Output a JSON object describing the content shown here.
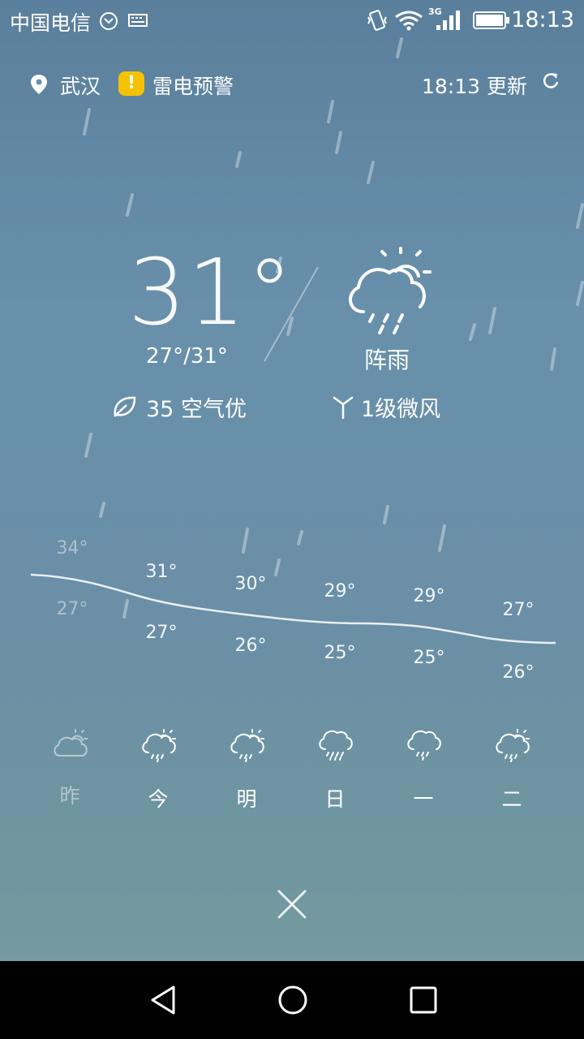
{
  "status_bar": {
    "carrier": "中国电信",
    "network": "3G",
    "time": "18:13"
  },
  "header": {
    "location": "武汉",
    "warning_mark": "!",
    "warning": "雷电预警",
    "update_time": "18:13 更新",
    "warning_color": "#f6c200"
  },
  "current": {
    "temperature": "31°",
    "range": "27°/31°",
    "condition": "阵雨",
    "aqi": "35 空气优",
    "wind": "1级微风"
  },
  "forecast": {
    "days": [
      {
        "label": "昨",
        "high": "34°",
        "low": "27°",
        "icon": "cloudy-sun-icon",
        "past": true
      },
      {
        "label": "今",
        "high": "31°",
        "low": "27°",
        "icon": "showers-sun-icon",
        "past": false
      },
      {
        "label": "明",
        "high": "30°",
        "low": "26°",
        "icon": "showers-sun-icon",
        "past": false
      },
      {
        "label": "日",
        "high": "29°",
        "low": "25°",
        "icon": "rain-icon",
        "past": false
      },
      {
        "label": "一",
        "high": "29°",
        "low": "25°",
        "icon": "light-rain-icon",
        "past": false
      },
      {
        "label": "二",
        "high": "27°",
        "low": "26°",
        "icon": "showers-sun-icon",
        "past": false
      }
    ]
  }
}
